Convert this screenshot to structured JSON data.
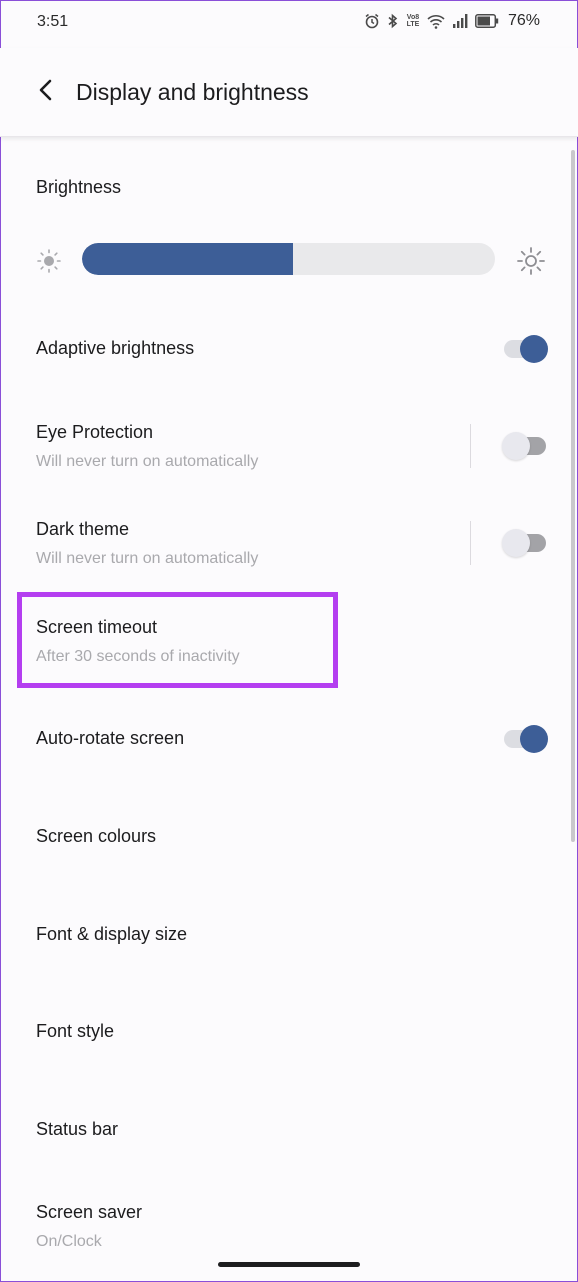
{
  "status_bar": {
    "time": "3:51",
    "lte_top": "Vo8",
    "lte_bottom": "LTE",
    "battery_percent": "76%",
    "icons": [
      "alarm-icon",
      "bluetooth-icon",
      "volte-icon",
      "wifi-icon",
      "signal-icon",
      "battery-icon"
    ]
  },
  "header": {
    "title": "Display and brightness",
    "back_icon": "back-arrow-icon"
  },
  "brightness": {
    "section_title": "Brightness",
    "level": 0.51,
    "accent_color": "#3d5e97"
  },
  "settings": [
    {
      "label": "Adaptive brightness",
      "toggle": true
    },
    {
      "label": "Eye Protection",
      "subtitle": "Will never turn on automatically",
      "toggle": false
    },
    {
      "label": "Dark theme",
      "subtitle": "Will never turn on automatically",
      "toggle": false
    },
    {
      "label": "Screen timeout",
      "subtitle": "After 30 seconds of inactivity",
      "highlighted": true
    },
    {
      "label": "Auto-rotate screen",
      "toggle": true
    },
    {
      "label": "Screen colours"
    },
    {
      "label": "Font & display size"
    },
    {
      "label": "Font style"
    },
    {
      "label": "Status bar"
    },
    {
      "label": "Screen saver",
      "subtitle": "On/Clock"
    }
  ],
  "highlight_color": "#b43ef0"
}
